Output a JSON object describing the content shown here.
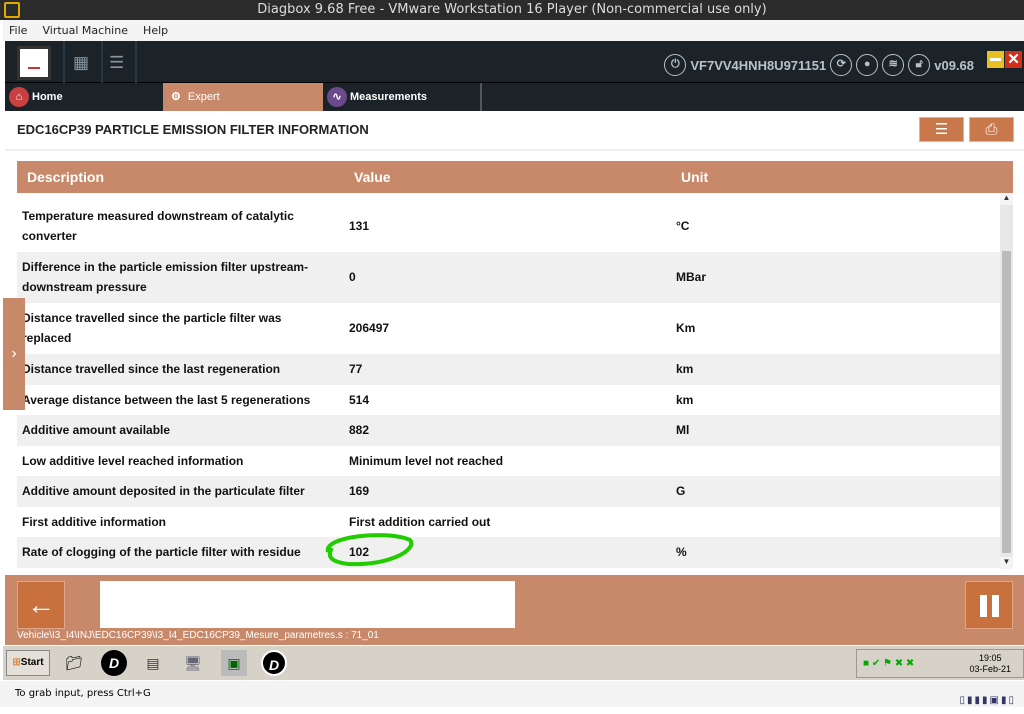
{
  "window": {
    "title": "Diagbox 9.68 Free - VMware Workstation 16 Player (Non-commercial use only)"
  },
  "menu": [
    "File",
    "Virtual Machine",
    "Help"
  ],
  "header": {
    "vin": "VF7VV4HNH8U971151",
    "version": "v09.68"
  },
  "tabs": [
    {
      "label": "Home"
    },
    {
      "label": "Expert"
    },
    {
      "label": "Measurements"
    }
  ],
  "page": {
    "title": "EDC16CP39 PARTICLE EMISSION FILTER INFORMATION"
  },
  "table": {
    "columns": [
      "Description",
      "Value",
      "Unit"
    ],
    "rows": [
      {
        "description": "Temperature measured downstream of catalytic converter",
        "value": "131",
        "unit": "°C"
      },
      {
        "description": "Difference in the particle emission filter upstream-downstream pressure",
        "value": "0",
        "unit": "MBar"
      },
      {
        "description": "Distance travelled since the particle filter was replaced",
        "value": "206497",
        "unit": "Km"
      },
      {
        "description": "Distance travelled since the last regeneration",
        "value": "77",
        "unit": "km"
      },
      {
        "description": "Average distance between the last 5 regenerations",
        "value": "514",
        "unit": "km"
      },
      {
        "description": "Additive amount available",
        "value": "882",
        "unit": "Ml"
      },
      {
        "description": "Low additive level reached information",
        "value": "Minimum level not reached",
        "unit": ""
      },
      {
        "description": "Additive amount deposited in the particulate filter",
        "value": "169",
        "unit": "G"
      },
      {
        "description": "First additive information",
        "value": "First addition carried out",
        "unit": ""
      },
      {
        "description": "Rate of clogging of the particle filter with residue",
        "value": "102",
        "unit": "%"
      }
    ]
  },
  "footer": {
    "path": "Vehicle\\I3_I4\\INJ\\EDC16CP39\\I3_I4_EDC16CP39_Mesure_parametres.s : 71_01"
  },
  "taskbar": {
    "start": "Start",
    "time": "19:05",
    "date": "03-Feb-21"
  },
  "status": {
    "text": "To grab input, press Ctrl+G"
  },
  "colors": {
    "accent": "#c8896a",
    "header": "#1b2328",
    "annotation": "#22cc00"
  }
}
